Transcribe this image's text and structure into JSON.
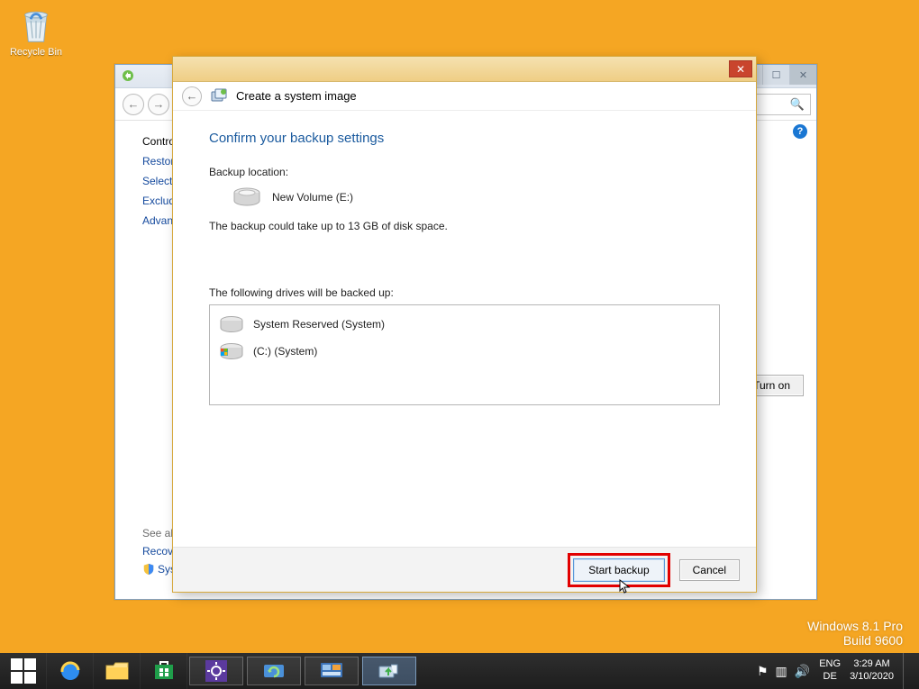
{
  "desktop": {
    "recycle_bin_label": "Recycle Bin"
  },
  "bg_window": {
    "sidebar": {
      "heading": "Contro",
      "items": [
        "Restor",
        "Select",
        "Exclud",
        "Advan"
      ]
    },
    "see_also": {
      "heading": "See als",
      "items": [
        "Recov",
        "Syster"
      ]
    },
    "turn_on_label": "Turn on"
  },
  "dialog": {
    "title": "Create a system image",
    "heading": "Confirm your backup settings",
    "backup_location_label": "Backup location:",
    "backup_location_value": "New Volume (E:)",
    "size_note": "The backup could take up to 13 GB of disk space.",
    "drives_label": "The following drives will be backed up:",
    "drives": {
      "0": {
        "label": "System Reserved (System)"
      },
      "1": {
        "label": "(C:) (System)"
      }
    },
    "start_label": "Start backup",
    "cancel_label": "Cancel"
  },
  "watermark": {
    "line1": "Windows 8.1 Pro",
    "line2": "Build 9600"
  },
  "taskbar": {
    "lang1": "ENG",
    "lang2": "DE",
    "time": "3:29 AM",
    "date": "3/10/2020"
  }
}
